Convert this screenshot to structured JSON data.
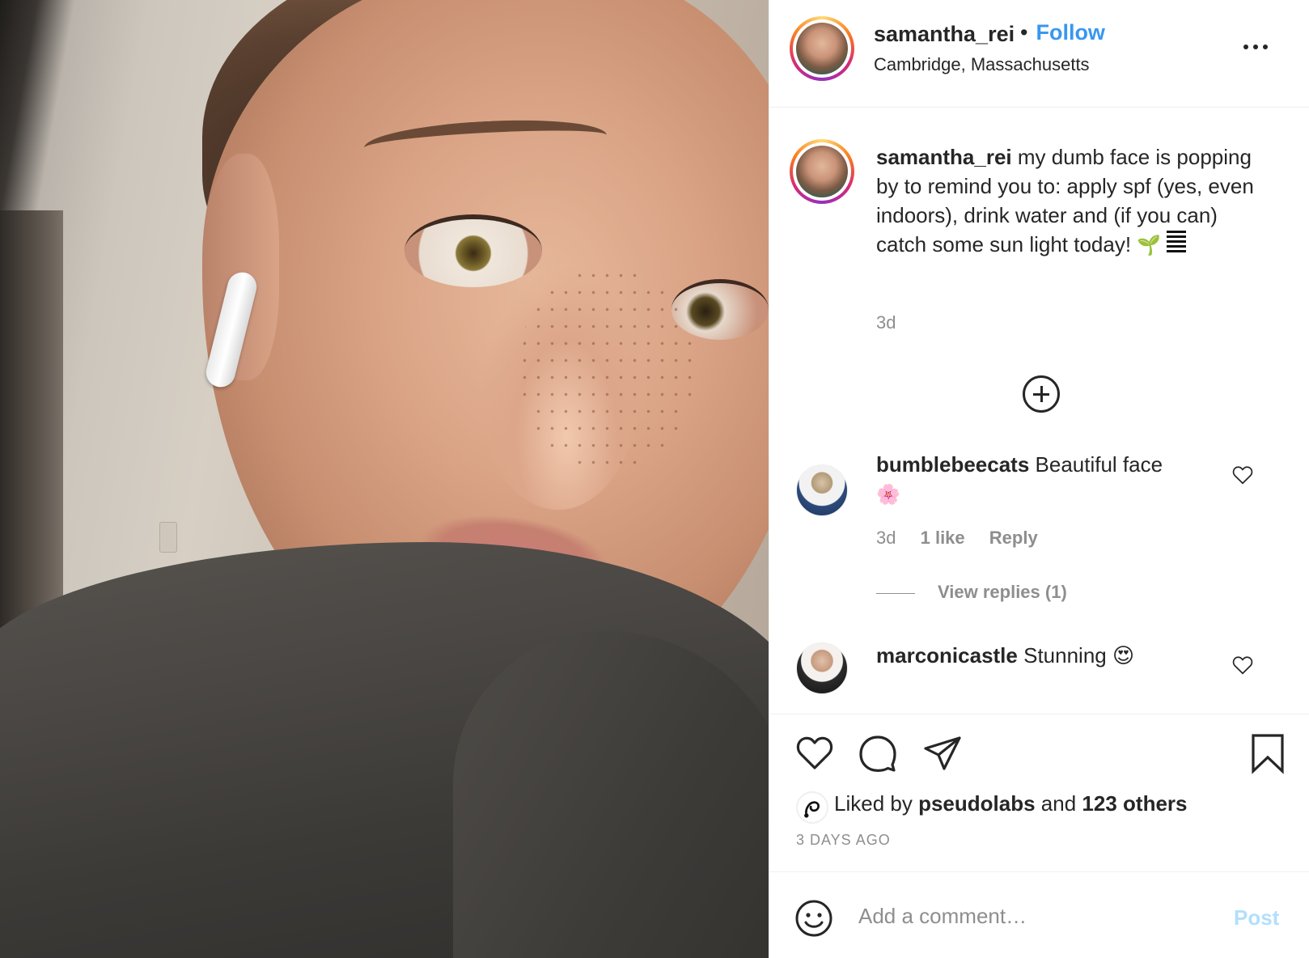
{
  "post": {
    "image_alt": "",
    "username": "samantha_rei",
    "follow_separator": "•",
    "follow_label": "Follow",
    "location": "Cambridge, Massachusetts",
    "more_icon": "more-horizontal-icon"
  },
  "caption": {
    "username": "samantha_rei",
    "text": "my dumb face is popping by to remind you to: apply spf (yes, even indoors), drink water and (if you can) catch some sun light today!",
    "emoji_1": "🌱",
    "time": "3d"
  },
  "load_more_icon": "plus-circle-icon",
  "comments": [
    {
      "username": "bumblebeecats",
      "text": "Beautiful face",
      "emoji": "🌸",
      "time": "3d",
      "likes": "1 like",
      "reply_label": "Reply",
      "view_replies": "View replies (1)"
    },
    {
      "username": "marconicastle",
      "text": "Stunning",
      "emoji": "😍"
    }
  ],
  "actions": {
    "icons": [
      "heart-icon",
      "comment-icon",
      "share-icon",
      "bookmark-icon"
    ],
    "liked_prefix": "Liked by",
    "liked_user": "pseudolabs",
    "liked_and": "and",
    "liked_others": "123 others",
    "date": "3 DAYS AGO"
  },
  "comment_box": {
    "placeholder": "Add a comment…",
    "post_label": "Post"
  },
  "colors": {
    "accent": "#3897f0",
    "muted": "#8e8e8e",
    "post_disabled": "#b2dffc",
    "text": "#262626"
  }
}
